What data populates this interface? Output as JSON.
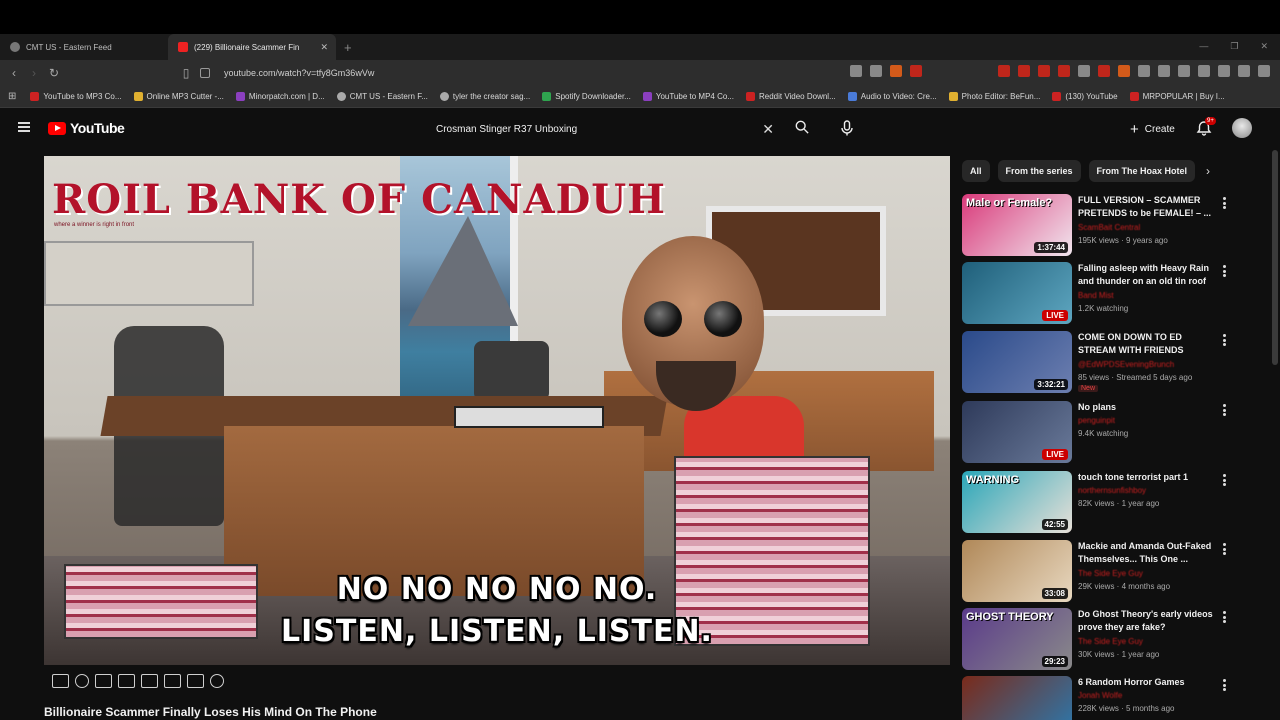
{
  "browser": {
    "tabs": [
      {
        "label": "CMT US - Eastern Feed",
        "active": false
      },
      {
        "label": "(229) Billionaire Scammer Fin",
        "active": true
      }
    ],
    "url": "youtube.com/watch?v=tfy8Gm36wVw",
    "bookmarks": [
      "YouTube to MP3 Co...",
      "Online MP3 Cutter -...",
      "Minorpatch.com | D...",
      "CMT US - Eastern F...",
      "tyler the creator sag...",
      "Spotify Downloader...",
      "YouTube to MP4 Co...",
      "Reddit Video Downl...",
      "Audio to Video: Cre...",
      "Photo Editor: BeFun...",
      "(130) YouTube",
      "MRPOPULAR | Buy I..."
    ]
  },
  "youtube": {
    "logo_text": "YouTube",
    "search_query": "Crosman Stinger R37 Unboxing",
    "create_label": "Create",
    "notification_count": "9+"
  },
  "player": {
    "overlay_title": "ROIL BANK OF CANADUH",
    "overlay_subtitle": "where a winner is right in front",
    "caption_line1": "NO NO NO NO NO.",
    "caption_line2": "LISTEN, LISTEN, LISTEN."
  },
  "video": {
    "title": "Billionaire Scammer Finally Loses His Mind On The Phone"
  },
  "chips": [
    "All",
    "From the series",
    "From The Hoax Hotel"
  ],
  "recommendations": [
    {
      "title": "FULL VERSION – SCAMMER PRETENDS to be FEMALE! – ...",
      "channel": "ScamBait Central",
      "meta": "195K views · 9 years ago",
      "badge": "1:37:44",
      "badge_type": "duration",
      "thumb_text": "Male or Female?",
      "colors": [
        "#d93a7a",
        "#f1e6ee"
      ]
    },
    {
      "title": "Falling asleep with Heavy Rain and thunder on an old tin roof |...",
      "channel": "Band Mist",
      "meta": "1.2K watching",
      "badge": "LIVE",
      "badge_type": "live",
      "thumb_text": "",
      "colors": [
        "#1f5f7a",
        "#5ea6c0"
      ]
    },
    {
      "title": "COME ON DOWN TO ED STREAM WITH FRIENDS",
      "channel": "@EdWPDSEveningBrunch",
      "meta": "85 views · Streamed 5 days ago",
      "badge": "3:32:21",
      "badge_type": "duration",
      "thumb_text": "",
      "colors": [
        "#2a4a8a",
        "#6d7fb0"
      ],
      "new": "New"
    },
    {
      "title": "No plans",
      "channel": "penguinpit",
      "meta": "9.4K watching",
      "badge": "LIVE",
      "badge_type": "live",
      "thumb_text": "",
      "colors": [
        "#2e3a5a",
        "#6a7a9a"
      ]
    },
    {
      "title": "touch tone terrorist part 1",
      "channel": "northernsunfishboy",
      "meta": "82K views · 1 year ago",
      "badge": "42:55",
      "badge_type": "duration",
      "thumb_text": "WARNING",
      "colors": [
        "#2aa6b8",
        "#e8e0d8"
      ]
    },
    {
      "title": "Mackie and Amanda Out-Faked Themselves... This One ...",
      "channel": "The Side Eye Guy",
      "meta": "29K views · 4 months ago",
      "badge": "33:08",
      "badge_type": "duration",
      "thumb_text": "",
      "colors": [
        "#b08858",
        "#e8d8c0"
      ]
    },
    {
      "title": "Do Ghost Theory's early videos prove they are fake?",
      "channel": "The Side Eye Guy",
      "meta": "30K views · 1 year ago",
      "badge": "29:23",
      "badge_type": "duration",
      "thumb_text": "GHOST THEORY",
      "colors": [
        "#5a3a8a",
        "#8a8a8a"
      ]
    },
    {
      "title": "6 Random Horror Games",
      "channel": "Jonah Wolfe",
      "meta": "228K views · 5 months ago",
      "badge": "",
      "badge_type": "none",
      "thumb_text": "",
      "colors": [
        "#7a2a1a",
        "#2a7ab0"
      ]
    }
  ]
}
